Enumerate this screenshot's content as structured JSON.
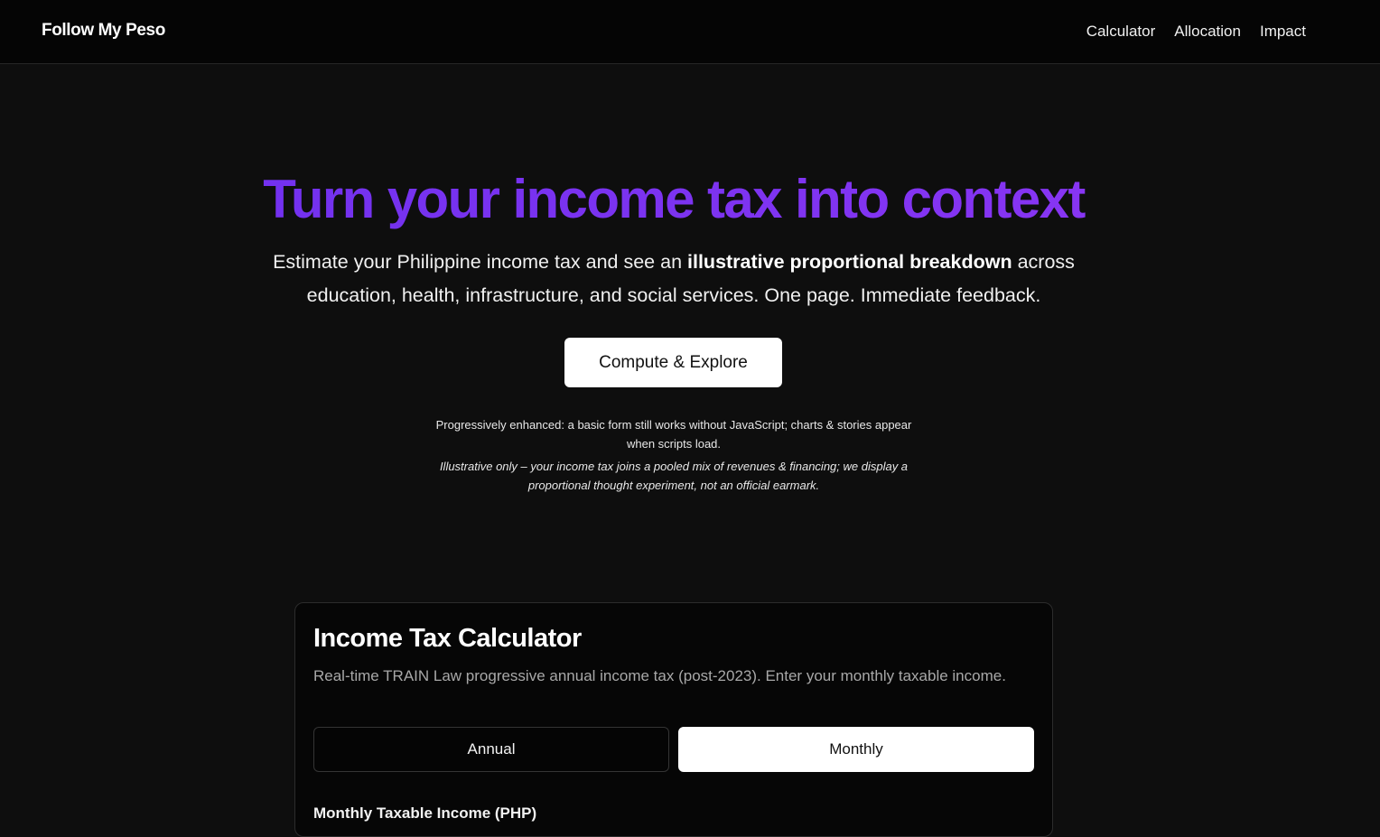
{
  "header": {
    "brand": "Follow My Peso",
    "nav": [
      "Calculator",
      "Allocation",
      "Impact"
    ]
  },
  "hero": {
    "title": "Turn your income tax into context",
    "subtitle_before": "Estimate your Philippine income tax and see an ",
    "subtitle_strong": "illustrative proportional breakdown",
    "subtitle_after": " across education, health, infrastructure, and social services. One page. Immediate feedback.",
    "cta_label": "Compute & Explore",
    "note": "Progressively enhanced: a basic form still works without JavaScript; charts & stories appear when scripts load.",
    "disclaimer": "Illustrative only – your income tax joins a pooled mix of revenues & financing; we display a proportional thought experiment, not an official earmark."
  },
  "calculator": {
    "title": "Income Tax Calculator",
    "description": "Real-time TRAIN Law progressive annual income tax (post-2023). Enter your monthly taxable income.",
    "modes": [
      "Annual",
      "Monthly"
    ],
    "selected_mode": "Monthly",
    "field_label": "Monthly Taxable Income (PHP)"
  },
  "colors": {
    "background": "#0e0e0e",
    "header_background": "#050505",
    "title_gradient_start": "#6d30ee",
    "title_gradient_end": "#8e36f5",
    "muted_text": "#a8a8a8"
  }
}
